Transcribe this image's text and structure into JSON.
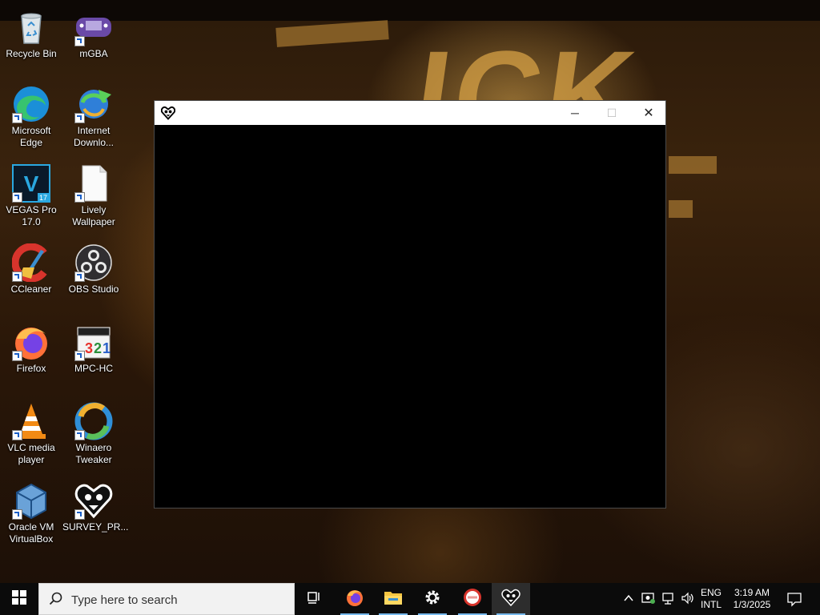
{
  "desktop": {
    "icons": [
      {
        "id": "recycle-bin",
        "label": "Recycle Bin"
      },
      {
        "id": "mgba",
        "label": "mGBA"
      },
      {
        "id": "edge",
        "label": "Microsoft Edge"
      },
      {
        "id": "idm",
        "label": "Internet Downlo..."
      },
      {
        "id": "vegas",
        "label": "VEGAS Pro 17.0"
      },
      {
        "id": "lively",
        "label": "Lively Wallpaper"
      },
      {
        "id": "ccleaner",
        "label": "CCleaner"
      },
      {
        "id": "obs",
        "label": "OBS Studio"
      },
      {
        "id": "firefox",
        "label": "Firefox"
      },
      {
        "id": "mpchc",
        "label": "MPC-HC"
      },
      {
        "id": "vlc",
        "label": "VLC media player"
      },
      {
        "id": "winaero",
        "label": "Winaero Tweaker"
      },
      {
        "id": "virtualbox",
        "label": "Oracle VM VirtualBox"
      },
      {
        "id": "survey",
        "label": "SURVEY_PR..."
      }
    ]
  },
  "window": {
    "title": "",
    "icon": "heart-skull-icon",
    "controls": {
      "minimize": "─",
      "maximize": "☐",
      "close": "✕"
    }
  },
  "taskbar": {
    "search_placeholder": "Type here to search",
    "apps": [
      "task-view-icon",
      "firefox-icon",
      "file-explorer-icon",
      "settings-icon",
      "survey-app-icon",
      "heart-skull-icon"
    ],
    "language_top": "ENG",
    "language_bottom": "INTL",
    "time": "3:19 AM",
    "date": "1/3/2025"
  },
  "colors": {
    "taskbar": "#0b0b0b",
    "accent": "#76b9ed",
    "window_bg": "#000000"
  }
}
